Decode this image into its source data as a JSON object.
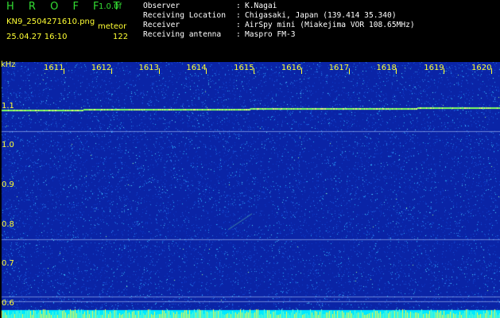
{
  "header": {
    "brand": "H R O F F T",
    "version": "1.0.0f",
    "filename": "KN9_2504271610.png",
    "mode": "meteor",
    "datetime": "25.04.27 16:10",
    "count": "122"
  },
  "meta": {
    "rows": [
      {
        "label": "Observer",
        "colon": ":",
        "value": "K.Nagai"
      },
      {
        "label": "Receiving Location",
        "colon": ":",
        "value": "Chigasaki, Japan (139.414 35.340)"
      },
      {
        "label": "Receiver",
        "colon": ":",
        "value": "AirSpy mini (Miakejima VOR 108.65MHz)"
      },
      {
        "label": "Receiving antenna",
        "colon": ":",
        "value": "Maspro FM-3"
      }
    ]
  },
  "chart_data": {
    "type": "heatmap",
    "ylabel": "kHz",
    "y_ticks": [
      "1.1",
      "1.0",
      "0.9",
      "0.8",
      "0.7",
      "0.6"
    ],
    "x_ticks": [
      "1611",
      "1612",
      "1613",
      "1614",
      "1615",
      "1616",
      "1617",
      "1618",
      "1619",
      "1620"
    ],
    "ylim": [
      0.59,
      1.18
    ],
    "xlim": [
      1610.5,
      1620.3
    ],
    "carrier_khz": 1.093,
    "faint_lines_khz": [
      1.04,
      0.765,
      0.62,
      0.608
    ],
    "colors": {
      "background": "#0a24a6",
      "noise": "#2ab8ff",
      "carrier": "#80ff60",
      "label": "#ffff33",
      "bottom_bar": "#00e8ff"
    }
  }
}
